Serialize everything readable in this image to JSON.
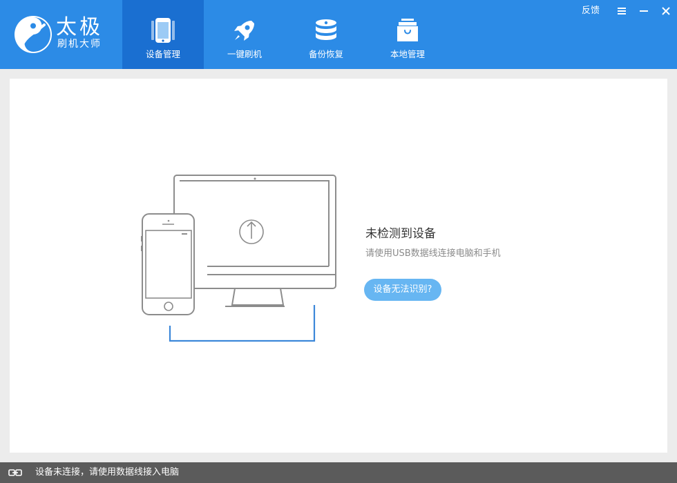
{
  "app": {
    "brand_title": "太极",
    "brand_subtitle": "刷机大师"
  },
  "nav": {
    "tabs": [
      {
        "label": "设备管理",
        "icon": "phone-icon",
        "active": true
      },
      {
        "label": "一键刷机",
        "icon": "rocket-icon",
        "active": false
      },
      {
        "label": "备份恢复",
        "icon": "database-icon",
        "active": false
      },
      {
        "label": "本地管理",
        "icon": "shopping-bag-icon",
        "active": false
      }
    ]
  },
  "window": {
    "feedback_label": "反馈",
    "menu_icon": "menu-icon",
    "minimize_icon": "minimize-icon",
    "close_icon": "close-icon"
  },
  "main": {
    "status_title": "未检测到设备",
    "status_description": "请使用USB数据线连接电脑和手机",
    "help_button_label": "设备无法识别?"
  },
  "statusbar": {
    "icon": "link-icon",
    "text": "设备未连接，请使用数据线接入电脑"
  },
  "colors": {
    "topbar": "#2c8be6",
    "active_tab": "#1a6fd1",
    "help_button": "#67b6f2",
    "cable": "#3b87d9",
    "statusbar": "#5b5b5b"
  }
}
